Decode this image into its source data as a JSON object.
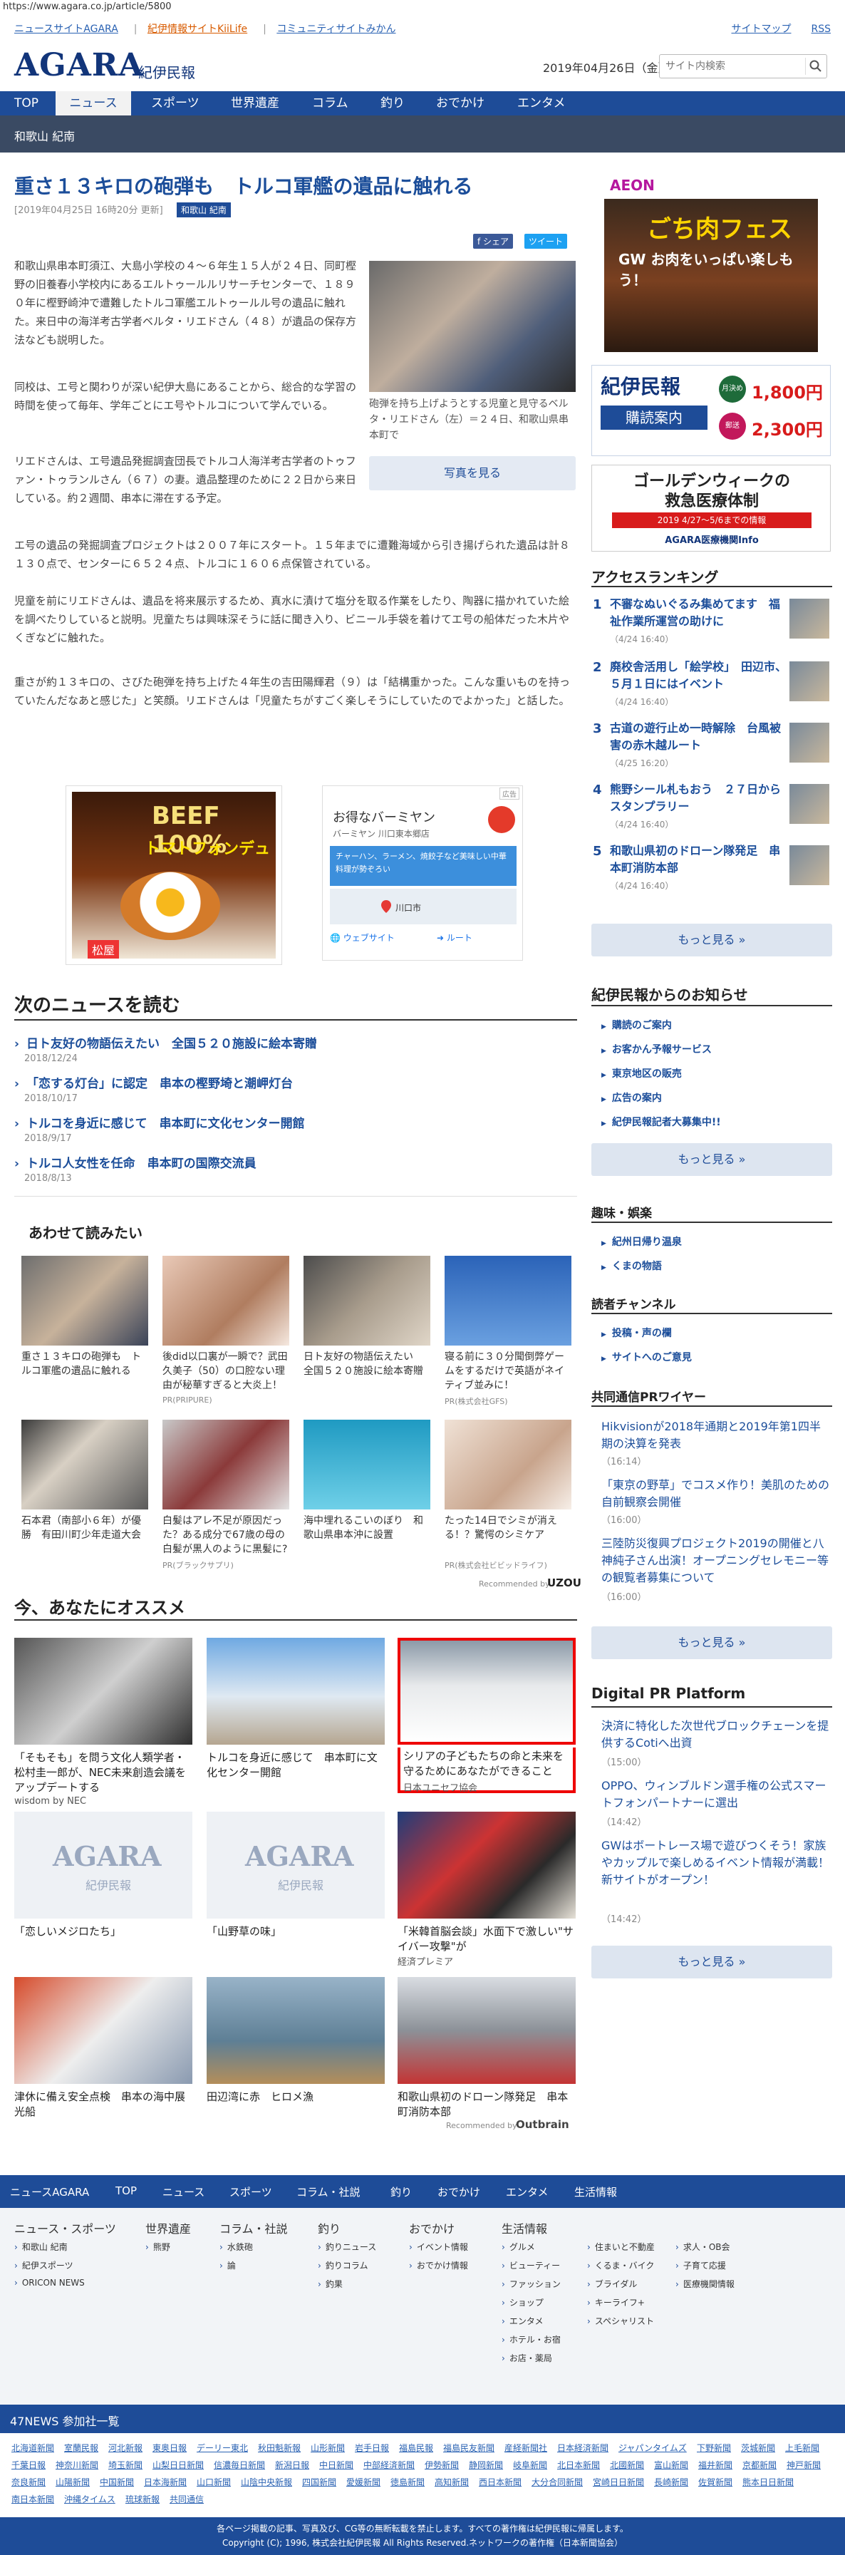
{
  "browser": {
    "url": "https://www.agara.co.jp/article/5800"
  },
  "top_links": {
    "left": [
      "ニュースサイトAGARA",
      "紀伊情報サイトKiiLife",
      "コミュニティサイトみかん"
    ],
    "right": [
      "サイトマップ",
      "RSS"
    ]
  },
  "header": {
    "logo": "AGARA",
    "logo_sub": "紀伊民報",
    "date": "2019年04月26日（金）",
    "search_placeholder": "サイト内検索"
  },
  "nav": {
    "items": [
      "TOP",
      "ニュース",
      "スポーツ",
      "世界遺産",
      "コラム",
      "釣り",
      "おでかけ",
      "エンタメ"
    ],
    "active": "ニュース"
  },
  "subnav": {
    "label": "和歌山 紀南"
  },
  "article": {
    "title": "重さ１３キロの砲弾も　トルコ軍艦の遺品に触れる",
    "meta": "[2019年04月25日 16時20分 更新]",
    "category": "和歌山 紀南",
    "share": "f シェア",
    "tweet": "ツイート",
    "photo_caption": "砲弾を持ち上げようとする児童と見守るベルタ・リエドさん（左）＝２４日、和歌山県串本町で",
    "photo_button": "写真を見る",
    "p1": "和歌山県串本町須江、大島小学校の４～６年生１５人が２４日、同町樫野の旧養春小学校内にあるエルトゥールルリサーチセンターで、１８９０年に樫野崎沖で遭難したトルコ軍艦エルトゥールル号の遺品に触れた。来日中の海洋考古学者ベルタ・リエドさん（４８）が遺品の保存方法なども説明した。",
    "p2": "同校は、エ号と関わりが深い紀伊大島にあることから、総合的な学習の時間を使って毎年、学年ごとにエ号やトルコについて学んでいる。",
    "p3": "リエドさんは、エ号遺品発掘調査団長でトルコ人海洋考古学者のトゥファン・トゥランルさん（６７）の妻。遺品整理のために２２日から来日している。約２週間、串本に滞在する予定。",
    "p4": "エ号の遺品の発掘調査プロジェクトは２００７年にスタート。１５年までに遭難海域から引き揚げられた遺品は計８１３０点で、センターに６５２４点、トルコに１６０６点保管されている。",
    "p5": "児童を前にリエドさんは、遺品を将来展示するため、真水に漬けて塩分を取る作業をしたり、陶器に描かれていた絵を調べたりしていると説明。児童たちは興味深そうに話に聞き入り、ビニール手袋を着けてエ号の船体だった木片やくぎなどに触れた。",
    "p6": "重さが約１３キロの、さびた砲弾を持ち上げた４年生の吉田陽輝君（９）は「結構重かった。こんな重いものを持っていたんだなあと感じた」と笑顔。リエドさんは「児童たちがすごく楽しそうにしていたのでよかった」と話した。"
  },
  "ads": {
    "left_title": "BEEF 100%",
    "left_sub": "トマトフォンデュ",
    "left_brand": "松屋",
    "right_label": "広告",
    "right_title": "お得なバーミヤン",
    "right_sub": "バーミヤン 川口東本郷店",
    "right_desc": "チャーハン、ラーメン、焼餃子など美味しい中華料理が勢ぞろい",
    "right_place": "川口市",
    "right_web": "ウェブサイト",
    "right_route": "ルート",
    "right_brand": "バーミヤン"
  },
  "next_news": {
    "heading": "次のニュースを読む",
    "items": [
      {
        "title": "日ト友好の物語伝えたい　全国５２０施設に絵本寄贈",
        "date": "2018/12/24"
      },
      {
        "title": "「恋する灯台」に認定　串本の樫野埼と潮岬灯台",
        "date": "2018/10/17"
      },
      {
        "title": "トルコを身近に感じて　串本町に文化センター開館",
        "date": "2018/9/17"
      },
      {
        "title": "トルコ人女性を任命　串本町の国際交流員",
        "date": "2018/8/13"
      }
    ]
  },
  "also_read": {
    "heading": "あわせて読みたい",
    "items": [
      {
        "title": "重さ１３キロの砲弾も　トルコ軍艦の遺品に触れる",
        "pr": ""
      },
      {
        "title": "後did以口裏が一瞬で？武田久美子（50）の口腔ない理由が秘華すぎると大炎上！",
        "pr": "PR(PRIPURE)"
      },
      {
        "title": "日ト友好の物語伝えたい　全国５２０施設に絵本寄贈",
        "pr": ""
      },
      {
        "title": "寝る前に３０分聞倒弊ゲームをするだけで英語がネイティブ並みに！",
        "pr": "PR(株式会社GFS)"
      },
      {
        "title": "石本君（南部小６年）が優勝　有田川町少年走道大会",
        "pr": ""
      },
      {
        "title": "白髪はアレ不足が原因だった？ある成分で67歳の母の白髪が黒人のように黒髪に?",
        "pr": "PR(ブラックサプリ)"
      },
      {
        "title": "海中埋れるこいのぼり　和歌山県串本沖に設置",
        "pr": ""
      },
      {
        "title": "たった14日でシミが消える！？驚愕のシミケア",
        "pr": "PR(株式会社ビビッドライフ)"
      }
    ],
    "recommended": "Recommended by",
    "brand": "UZOU"
  },
  "recommend": {
    "heading": "今、あなたにオススメ",
    "items": [
      {
        "title": "「そもそも」を問う文化人類学者・松村圭一郎が、NEC未来創造会議をアップデートする",
        "note": "wisdom by NEC"
      },
      {
        "title": "トルコを身近に感じて　串本町に文化センター開館",
        "note": ""
      },
      {
        "title": "シリアの子どもたちの命と未来を守るためにあなたができること",
        "note": "日本ユニセフ協会"
      },
      {
        "title": "「恋しいメジロたち」",
        "note": ""
      },
      {
        "title": "「山野草の味」",
        "note": ""
      },
      {
        "title": "「米韓首脳会談」水面下で激しい\"サイバー攻撃\"が",
        "note": "経済プレミア"
      },
      {
        "title": "津休に備え安全点検　串本の海中展光船",
        "note": ""
      },
      {
        "title": "田辺湾に赤　ヒロメ漁",
        "note": ""
      },
      {
        "title": "和歌山県初のドローン隊発足　串本町消防本部",
        "note": ""
      }
    ],
    "logo_text": "AGARA",
    "logo_sub": "紀伊民報",
    "recommended": "Recommended by",
    "brand": "Outbrain"
  },
  "sidebar": {
    "ad1_title": "ごち肉フェス",
    "ad1_sub": "GW お肉をいっぱい楽しもう！",
    "ad1_brand": "AEON",
    "sub_title": "紀伊民報",
    "sub_btn": "購読案内",
    "sub_price1": "1,800円",
    "sub_price2": "2,300円",
    "sub_label1": "月決め",
    "sub_label2": "郵送",
    "gw_title": "ゴールデンウィークの",
    "gw_title2": "救急医療体制",
    "gw_date": "2019 4/27～5/6までの情報",
    "gw_brand": "AGARA医療機関Info",
    "ranking": {
      "heading": "アクセスランキング",
      "items": [
        {
          "n": "1",
          "title": "不審なぬいぐるみ集めてます　福祉作業所運営の助けに",
          "date": "（4/24 16:40）"
        },
        {
          "n": "2",
          "title": "廃校舎活用し「絵学校」　田辺市、５月１日にはイベント",
          "date": "（4/24 16:40）"
        },
        {
          "n": "3",
          "title": "古道の遊行止め一時解除　台風被害の赤木越ルート",
          "date": "（4/25 16:20）"
        },
        {
          "n": "4",
          "title": "熊野シール札もおう　２７日からスタンプラリー",
          "date": "（4/24 16:40）"
        },
        {
          "n": "5",
          "title": "和歌山県初のドローン隊発足　串本町消防本部",
          "date": "（4/24 16:40）"
        }
      ],
      "more": "もっと見る »"
    },
    "notice": {
      "heading": "紀伊民報からのお知らせ",
      "items": [
        "購読のご案内",
        "お客かん予報サービス",
        "東京地区の販売",
        "広告の案内",
        "紀伊民報記者大募集中!!"
      ],
      "more": "もっと見る »"
    },
    "hobby": {
      "heading": "趣味・娯楽",
      "items": [
        "紀州日帰り温泉",
        "くまの物語"
      ]
    },
    "reader": {
      "heading": "読者チャンネル",
      "items": [
        "投稿・声の欄",
        "サイトへのご意見"
      ]
    },
    "kyodo": {
      "heading": "共同通信PRワイヤー",
      "items": [
        {
          "title": "Hikvisionが2018年通期と2019年第1四半期の決算を発表",
          "date": "（16:14）"
        },
        {
          "title": "「東京の野草」でコスメ作り！美肌のための自前観察会開催",
          "date": "（16:00）"
        },
        {
          "title": "三陸防災復興プロジェクト2019の開催と八神純子さん出演！オープニングセレモニー等の観覧者募集について",
          "date": "（16:00）"
        }
      ],
      "more": "もっと見る »"
    },
    "digital": {
      "heading": "Digital PR Platform",
      "items": [
        {
          "title": "決済に特化した次世代ブロックチェーンを提供するCotiへ出資",
          "date": "（15:00）"
        },
        {
          "title": "OPPO、ウィンブルドン選手権の公式スマートフォンパートナーに選出",
          "date": "（14:42）"
        },
        {
          "title": "GWはボートレース場で遊びつくそう！家族やカップルで楽しめるイベント情報が満載！新サイトがオープン！",
          "date": "（14:42）"
        }
      ],
      "more": "もっと見る »"
    }
  },
  "footer": {
    "nav": [
      "ニュースAGARA",
      "TOP",
      "ニュース",
      "スポーツ",
      "コラム・社説",
      "釣り",
      "おでかけ",
      "エンタメ",
      "生活情報"
    ],
    "cols": [
      {
        "h": "ニュース・スポーツ",
        "items": [
          "和歌山 紀南",
          "紀伊スポーツ",
          "ORICON NEWS"
        ]
      },
      {
        "h": "世界遺産",
        "items": [
          "熊野"
        ]
      },
      {
        "h": "コラム・社説",
        "items": [
          "水鉄砲",
          "論"
        ]
      },
      {
        "h": "釣り",
        "items": [
          "釣りニュース",
          "釣りコラム",
          "釣果"
        ]
      },
      {
        "h": "おでかけ",
        "items": [
          "イベント情報",
          "おでかけ情報"
        ]
      },
      {
        "h": "生活情報",
        "items": [
          "グルメ",
          "ビューティー",
          "ファッション",
          "ショップ",
          "エンタメ",
          "ホテル・お宿",
          "お店・薬局"
        ]
      },
      {
        "h": "",
        "items": [
          "住まいと不動産",
          "くるま・バイク",
          "ブライダル",
          "キーライフ+",
          "スペシャリスト"
        ]
      },
      {
        "h": "",
        "items": [
          "求人・OB会",
          "子育て応援",
          "医療機関情報"
        ]
      }
    ],
    "n47": "47NEWS 参加社一覧",
    "papers": [
      "北海道新聞",
      "室蘭民報",
      "河北新報",
      "東奥日報",
      "デーリー東北",
      "秋田魁新報",
      "山形新聞",
      "岩手日報",
      "福島民報",
      "福島民友新聞",
      "産経新聞社",
      "日本経済新聞",
      "ジャパンタイムズ",
      "下野新聞",
      "茨城新聞",
      "上毛新聞",
      "千葉日報",
      "神奈川新聞",
      "埼玉新聞",
      "山梨日日新聞",
      "信濃毎日新聞",
      "新潟日報",
      "中日新聞",
      "中部経済新聞",
      "伊勢新聞",
      "静岡新聞",
      "岐阜新聞",
      "北日本新聞",
      "北國新聞",
      "富山新聞",
      "福井新聞",
      "京都新聞",
      "神戸新聞",
      "奈良新聞",
      "山陽新聞",
      "中国新聞",
      "日本海新聞",
      "山口新聞",
      "山陰中央新報",
      "四国新聞",
      "愛媛新聞",
      "徳島新聞",
      "高知新聞",
      "西日本新聞",
      "大分合同新聞",
      "宮崎日日新聞",
      "長崎新聞",
      "佐賀新聞",
      "熊本日日新聞",
      "南日本新聞",
      "沖縄タイムス",
      "琉球新報",
      "共同通信"
    ],
    "copy1": "各ページ掲載の記事、写真及び、CG等の無断転載を禁止します。すべての著作権は紀伊民報に帰属します。",
    "copy2": "Copyright (C); 1996, 株式会社紀伊民報 All Rights Reserved.ネットワークの著作権（日本新聞協会）"
  }
}
